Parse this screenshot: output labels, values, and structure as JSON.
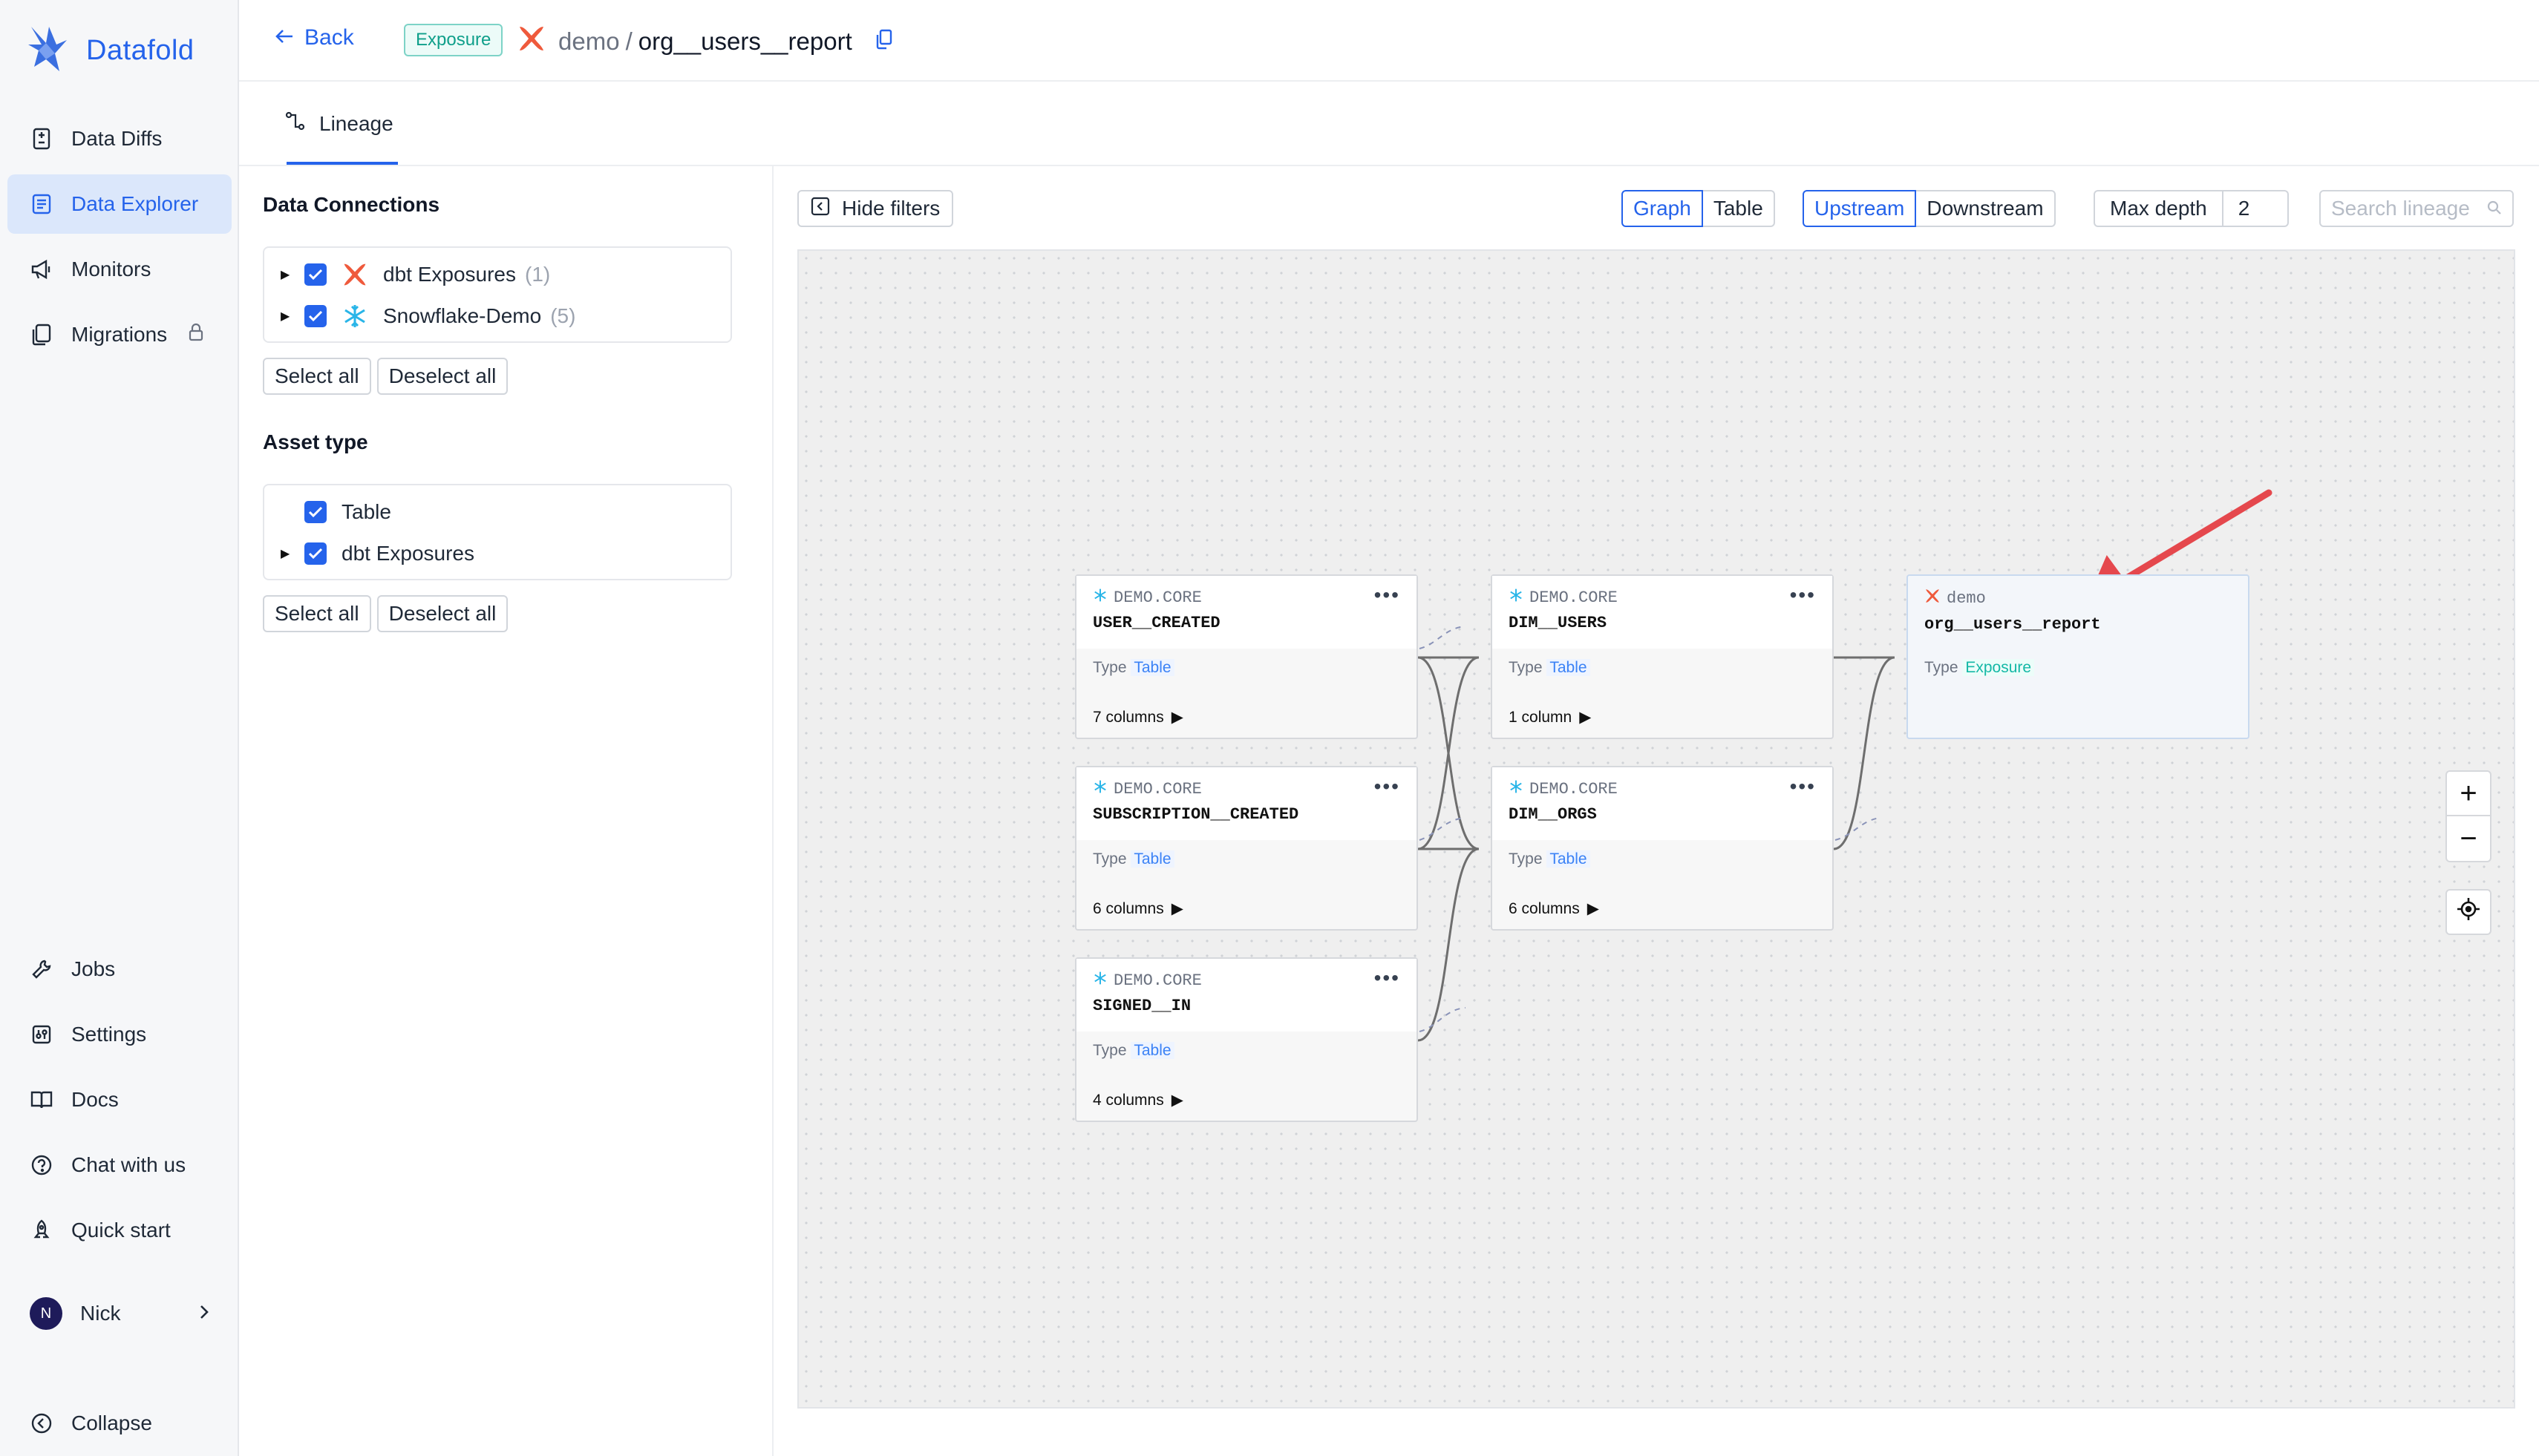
{
  "sidebar": {
    "brand": "Datafold",
    "nav_top": [
      {
        "label": "Data Diffs",
        "icon": "diff-icon"
      },
      {
        "label": "Data Explorer",
        "icon": "explorer-icon",
        "active": true
      },
      {
        "label": "Monitors",
        "icon": "megaphone-icon"
      },
      {
        "label": "Migrations",
        "icon": "migrations-icon",
        "locked": true
      }
    ],
    "nav_bottom": [
      {
        "label": "Jobs",
        "icon": "wrench-icon"
      },
      {
        "label": "Settings",
        "icon": "settings-icon"
      },
      {
        "label": "Docs",
        "icon": "book-icon"
      },
      {
        "label": "Chat with us",
        "icon": "help-icon"
      },
      {
        "label": "Quick start",
        "icon": "rocket-icon"
      }
    ],
    "user": {
      "initial": "N",
      "name": "Nick"
    },
    "collapse_label": "Collapse"
  },
  "header": {
    "back_label": "Back",
    "type_badge": "Exposure",
    "namespace": "demo",
    "separator": "/",
    "name": "org__users__report"
  },
  "tabs": [
    {
      "label": "Lineage",
      "active": true
    }
  ],
  "filters": {
    "connections_title": "Data Connections",
    "connections": [
      {
        "label": "dbt Exposures",
        "count": "(1)",
        "checked": true,
        "icon": "dbt-icon"
      },
      {
        "label": "Snowflake-Demo",
        "count": "(5)",
        "checked": true,
        "icon": "snowflake-icon"
      }
    ],
    "asset_type_title": "Asset type",
    "asset_types": [
      {
        "label": "Table",
        "checked": true,
        "expandable": false
      },
      {
        "label": "dbt Exposures",
        "checked": true,
        "expandable": true
      }
    ],
    "select_all": "Select all",
    "deselect_all": "Deselect all"
  },
  "toolbar": {
    "hide_filters": "Hide filters",
    "view_modes": [
      "Graph",
      "Table"
    ],
    "view_selected": "Graph",
    "directions": [
      "Upstream",
      "Downstream"
    ],
    "direction_selected": "Upstream",
    "max_depth_label": "Max depth",
    "max_depth_value": "2",
    "search_placeholder": "Search lineage"
  },
  "graph": {
    "nodes": [
      {
        "id": "user_created",
        "ns": "DEMO.CORE",
        "name": "USER__CREATED",
        "type_label": "Type",
        "type": "Table",
        "columns": "7 columns",
        "icon": "snowflake-icon"
      },
      {
        "id": "subscription_created",
        "ns": "DEMO.CORE",
        "name": "SUBSCRIPTION__CREATED",
        "type_label": "Type",
        "type": "Table",
        "columns": "6 columns",
        "icon": "snowflake-icon"
      },
      {
        "id": "signed_in",
        "ns": "DEMO.CORE",
        "name": "SIGNED__IN",
        "type_label": "Type",
        "type": "Table",
        "columns": "4 columns",
        "icon": "snowflake-icon"
      },
      {
        "id": "dim_users",
        "ns": "DEMO.CORE",
        "name": "DIM__USERS",
        "type_label": "Type",
        "type": "Table",
        "columns": "1 column",
        "icon": "snowflake-icon"
      },
      {
        "id": "dim_orgs",
        "ns": "DEMO.CORE",
        "name": "DIM__ORGS",
        "type_label": "Type",
        "type": "Table",
        "columns": "6 columns",
        "icon": "snowflake-icon"
      },
      {
        "id": "org_users_report",
        "ns": "demo",
        "name": "org__users__report",
        "type_label": "Type",
        "type": "Exposure",
        "icon": "dbt-icon"
      }
    ],
    "edges": [
      [
        "user_created",
        "dim_users"
      ],
      [
        "user_created",
        "dim_orgs"
      ],
      [
        "subscription_created",
        "dim_users"
      ],
      [
        "subscription_created",
        "dim_orgs"
      ],
      [
        "signed_in",
        "dim_orgs"
      ],
      [
        "dim_users",
        "org_users_report"
      ],
      [
        "dim_orgs",
        "org_users_report"
      ]
    ],
    "zoom_in": "+",
    "zoom_out": "−"
  },
  "colors": {
    "accent": "#2563eb",
    "exposure_badge": "#0f9f8a",
    "dbt": "#ef5a3c",
    "snowflake": "#29b5e8",
    "annotation_arrow": "#e5484d"
  }
}
